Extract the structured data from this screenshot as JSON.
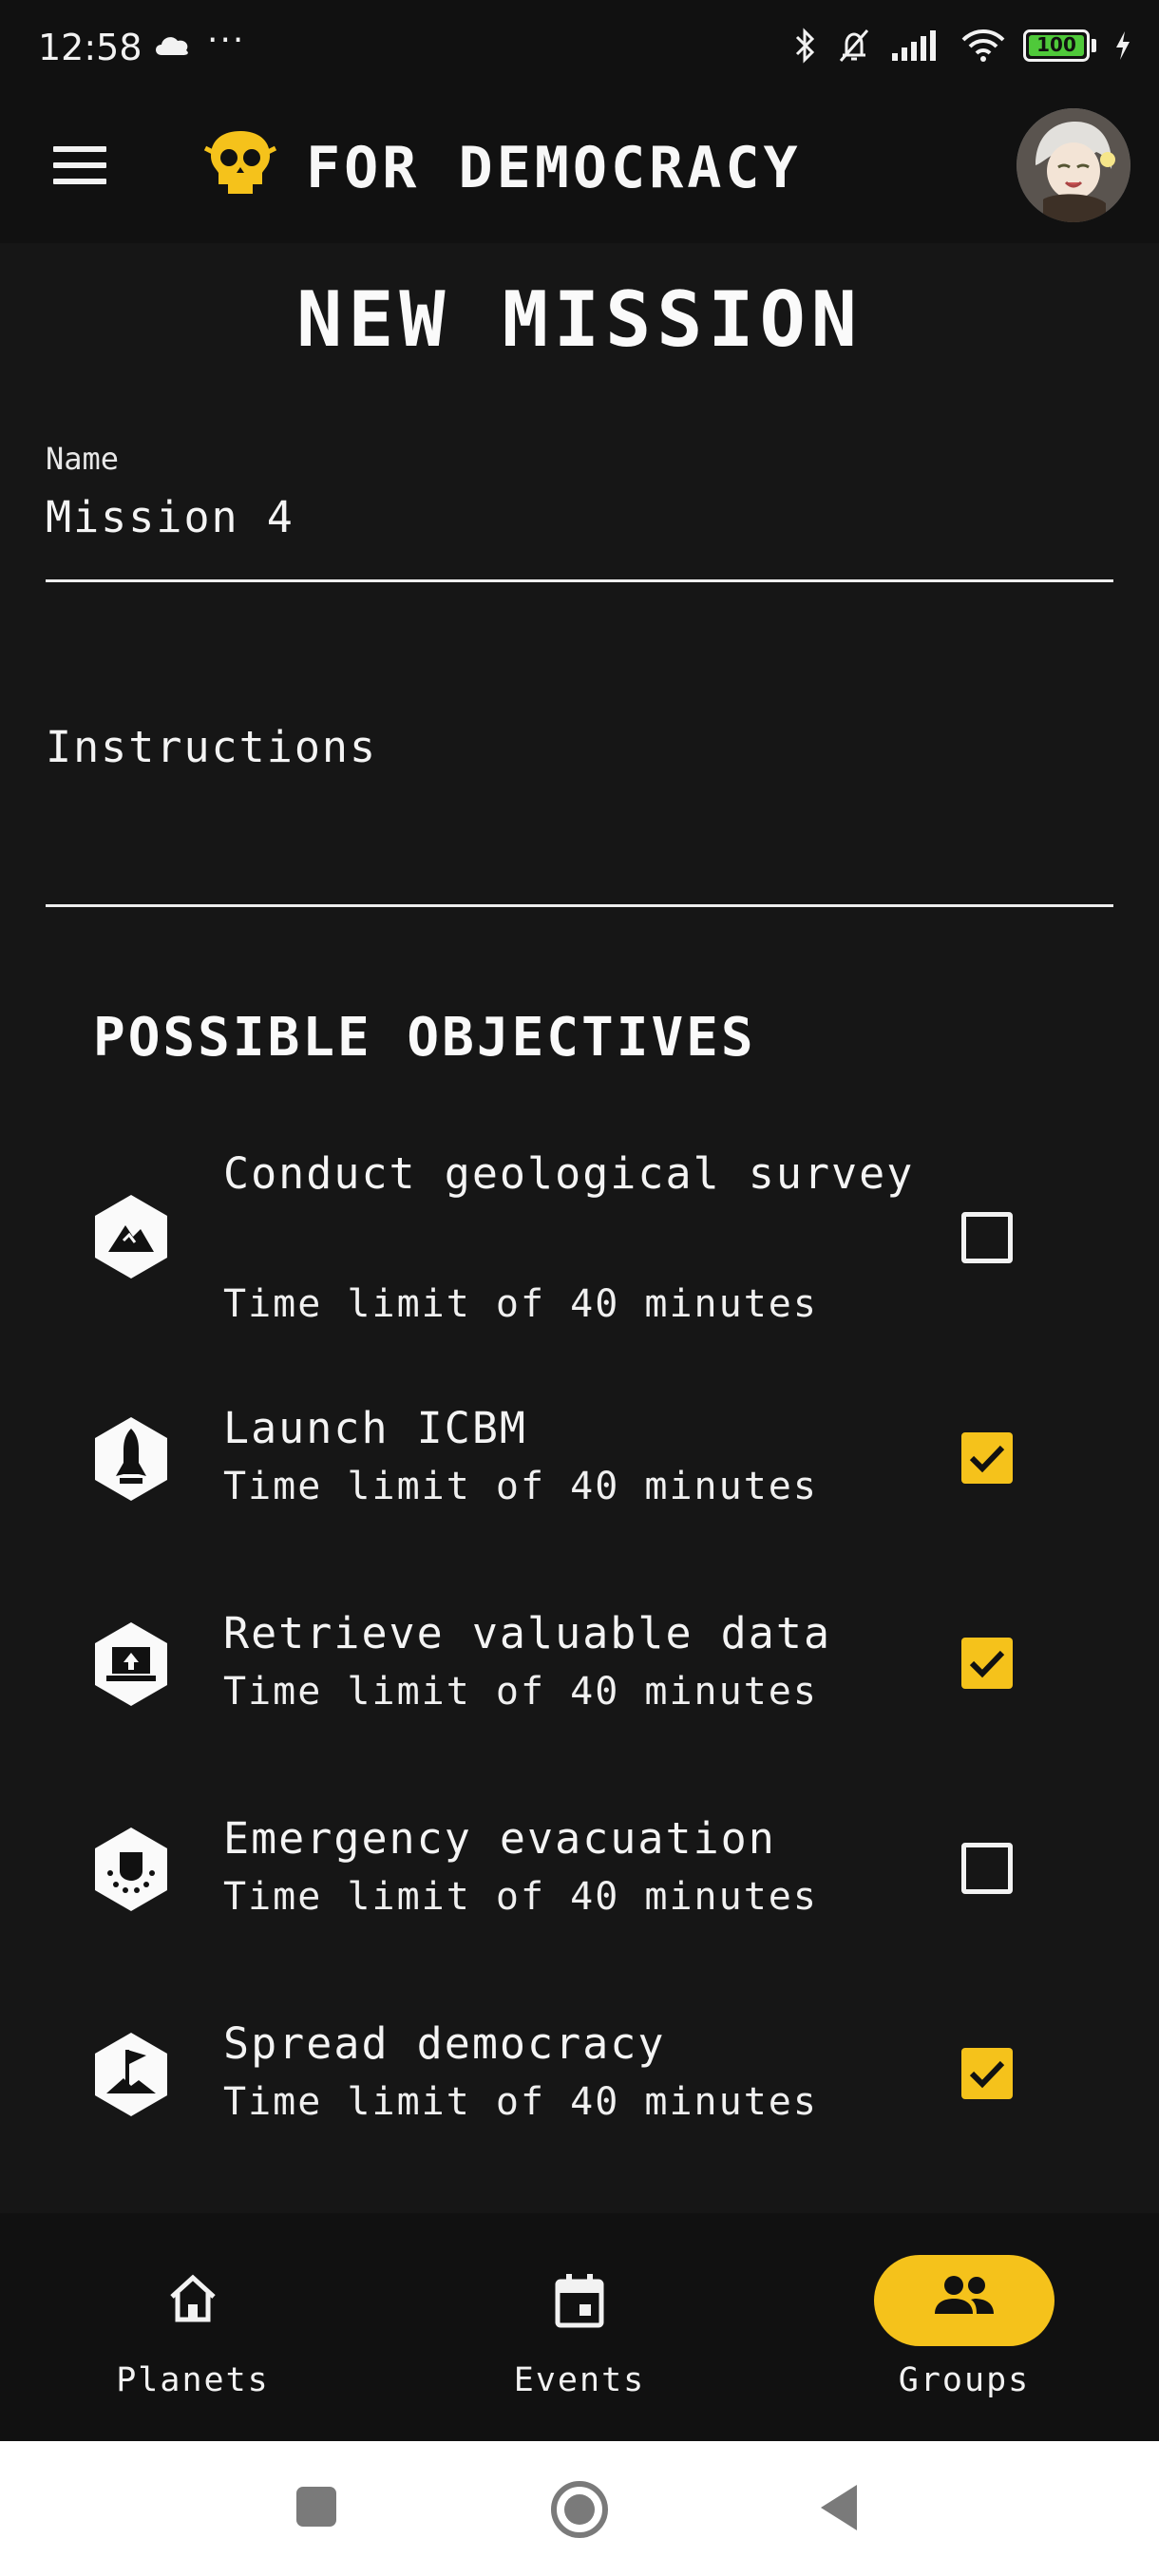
{
  "status_bar": {
    "time": "12:58",
    "more": "···",
    "battery": "100"
  },
  "app_bar": {
    "title": "FOR DEMOCRACY"
  },
  "page": {
    "title": "NEW MISSION"
  },
  "form": {
    "name_label": "Name",
    "name_value": "Mission 4",
    "instructions_placeholder": "Instructions"
  },
  "objectives": {
    "heading": "POSSIBLE OBJECTIVES",
    "items": [
      {
        "title": "Conduct geological survey",
        "subtitle": "Time limit of 40 minutes",
        "checked": false,
        "icon": "mountain-icon"
      },
      {
        "title": "Launch ICBM",
        "subtitle": "Time limit of 40 minutes",
        "checked": true,
        "icon": "rocket-icon"
      },
      {
        "title": "Retrieve valuable data",
        "subtitle": "Time limit of 40 minutes",
        "checked": true,
        "icon": "laptop-upload-icon"
      },
      {
        "title": "Emergency evacuation",
        "subtitle": "Time limit of 40 minutes",
        "checked": false,
        "icon": "evacuation-icon"
      },
      {
        "title": "Spread democracy",
        "subtitle": "Time limit of 40 minutes",
        "checked": true,
        "icon": "flag-icon"
      }
    ]
  },
  "bottom_nav": {
    "items": [
      {
        "label": "Planets",
        "icon": "home-icon",
        "active": false
      },
      {
        "label": "Events",
        "icon": "calendar-icon",
        "active": false
      },
      {
        "label": "Groups",
        "icon": "group-icon",
        "active": true
      }
    ]
  },
  "colors": {
    "background": "#161616",
    "bar": "#111111",
    "accent": "#f5c21b",
    "text": "#f2f2f2"
  }
}
